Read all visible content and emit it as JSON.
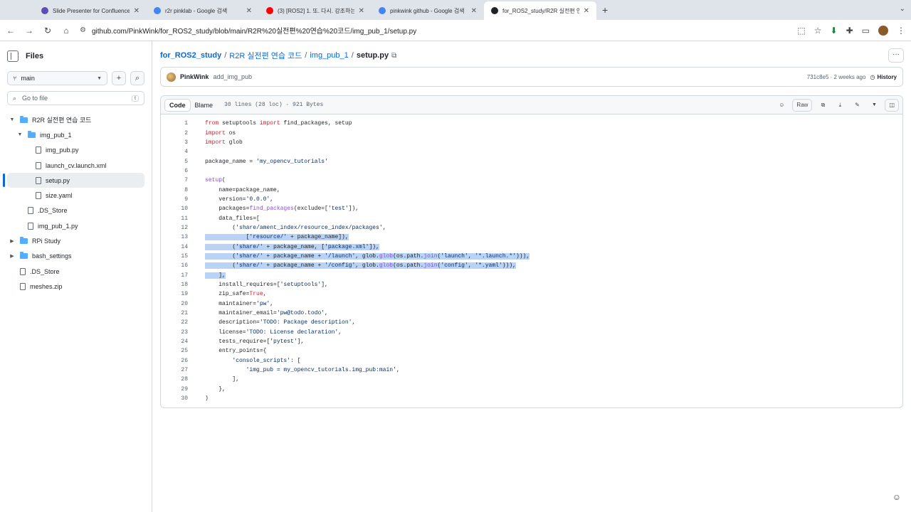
{
  "browser": {
    "tabs": [
      {
        "title": "Slide Presenter for Confluence",
        "color": "#5e4db2",
        "active": false
      },
      {
        "title": "r2r pinklab - Google 검색",
        "color": "#4285f4",
        "active": false
      },
      {
        "title": "(3) [ROS2] 1. 또. 다시. 강조하는",
        "color": "#ff0000",
        "active": false
      },
      {
        "title": "pinkwink github - Google 검색",
        "color": "#4285f4",
        "active": false
      },
      {
        "title": "for_ROS2_study/R2R 실전편 연",
        "color": "#1f2328",
        "active": true
      }
    ],
    "url": "github.com/PinkWink/for_ROS2_study/blob/main/R2R%20실전편%20연습%20코드/img_pub_1/setup.py"
  },
  "sidebar": {
    "title": "Files",
    "branch": "main",
    "goto_placeholder": "Go to file",
    "goto_kbd": "t",
    "tree": [
      {
        "label": "R2R 실전편 연습 코드",
        "type": "folder",
        "depth": 0,
        "expanded": true
      },
      {
        "label": "img_pub_1",
        "type": "folder",
        "depth": 1,
        "expanded": true
      },
      {
        "label": "img_pub.py",
        "type": "file",
        "depth": 2
      },
      {
        "label": "launch_cv.launch.xml",
        "type": "file",
        "depth": 2
      },
      {
        "label": "setup.py",
        "type": "file",
        "depth": 2,
        "selected": true
      },
      {
        "label": "size.yaml",
        "type": "file",
        "depth": 2
      },
      {
        "label": ".DS_Store",
        "type": "file",
        "depth": 1
      },
      {
        "label": "img_pub_1.py",
        "type": "file",
        "depth": 1
      },
      {
        "label": "RPi Study",
        "type": "folder",
        "depth": 0,
        "expanded": false
      },
      {
        "label": "bash_settings",
        "type": "folder",
        "depth": 0,
        "expanded": false
      },
      {
        "label": ".DS_Store",
        "type": "file",
        "depth": 0
      },
      {
        "label": "meshes.zip",
        "type": "file",
        "depth": 0
      }
    ]
  },
  "breadcrumb": {
    "repo": "for_ROS2_study",
    "folder": "R2R 실전편 연습 코드",
    "subfolder": "img_pub_1",
    "file": "setup.py"
  },
  "commit": {
    "user": "PinkWink",
    "message": "add_img_pub",
    "meta": "731c8e5 · 2 weeks ago",
    "history": "History"
  },
  "codeview": {
    "tab_code": "Code",
    "tab_blame": "Blame",
    "fileinfo": "30 lines (28 loc) · 921 Bytes",
    "raw": "Raw"
  },
  "code_lines": [
    {
      "n": "1",
      "html": "<span class='kw'>from</span> setuptools <span class='kw'>import</span> find_packages, setup"
    },
    {
      "n": "2",
      "html": "<span class='kw'>import</span> os"
    },
    {
      "n": "3",
      "html": "<span class='kw'>import</span> glob"
    },
    {
      "n": "4",
      "html": ""
    },
    {
      "n": "5",
      "html": "package_name = <span class='str'>'my_opencv_tutorials'</span>"
    },
    {
      "n": "6",
      "html": ""
    },
    {
      "n": "7",
      "html": "<span class='fn'>setup</span>("
    },
    {
      "n": "8",
      "html": "    name=package_name,"
    },
    {
      "n": "9",
      "html": "    version=<span class='str'>'0.0.0'</span>,"
    },
    {
      "n": "10",
      "html": "    packages=<span class='fn'>find_packages</span>(exclude=[<span class='str'>'test'</span>]),"
    },
    {
      "n": "11",
      "html": "    data_files=["
    },
    {
      "n": "12",
      "html": "        (<span class='str'>'share/ament_index/resource_index/packages'</span>,"
    },
    {
      "n": "13",
      "html": "            [<span class='str'>'resource/'</span> + package_name]),",
      "hl": true
    },
    {
      "n": "14",
      "html": "        (<span class='str'>'share/'</span> + package_name, [<span class='str'>'package.xml'</span>]),",
      "hl": true
    },
    {
      "n": "15",
      "html": "        (<span class='str'>'share/'</span> + package_name + <span class='str'>'/launch'</span>, glob.<span class='fn'>glob</span>(os.path.<span class='fn'>join</span>(<span class='str'>'launch'</span>, <span class='str'>'*.launch.*'</span>))),",
      "hl": true
    },
    {
      "n": "16",
      "html": "        (<span class='str'>'share/'</span> + package_name + <span class='str'>'/config'</span>, glob.<span class='fn'>glob</span>(os.path.<span class='fn'>join</span>(<span class='str'>'config'</span>, <span class='str'>'*.yaml'</span>))),",
      "hl": true
    },
    {
      "n": "17",
      "html": "    ],",
      "hl": true
    },
    {
      "n": "18",
      "html": "    install_requires=[<span class='str'>'setuptools'</span>],"
    },
    {
      "n": "19",
      "html": "    zip_safe=<span class='kw'>True</span>,"
    },
    {
      "n": "20",
      "html": "    maintainer=<span class='str'>'pw'</span>,"
    },
    {
      "n": "21",
      "html": "    maintainer_email=<span class='str'>'pw@todo.todo'</span>,"
    },
    {
      "n": "22",
      "html": "    description=<span class='str'>'TODO: Package description'</span>,"
    },
    {
      "n": "23",
      "html": "    license=<span class='str'>'TODO: License declaration'</span>,"
    },
    {
      "n": "24",
      "html": "    tests_require=[<span class='str'>'pytest'</span>],"
    },
    {
      "n": "25",
      "html": "    entry_points={"
    },
    {
      "n": "26",
      "html": "        <span class='str'>'console_scripts'</span>: ["
    },
    {
      "n": "27",
      "html": "            <span class='str'>'img_pub = my_opencv_tutorials.img_pub:main'</span>,"
    },
    {
      "n": "28",
      "html": "        ],"
    },
    {
      "n": "29",
      "html": "    },"
    },
    {
      "n": "30",
      "html": ")"
    }
  ],
  "colors": {
    "accent": "#0969da",
    "folder": "#54aeff",
    "selection": "#b8d3f5"
  }
}
